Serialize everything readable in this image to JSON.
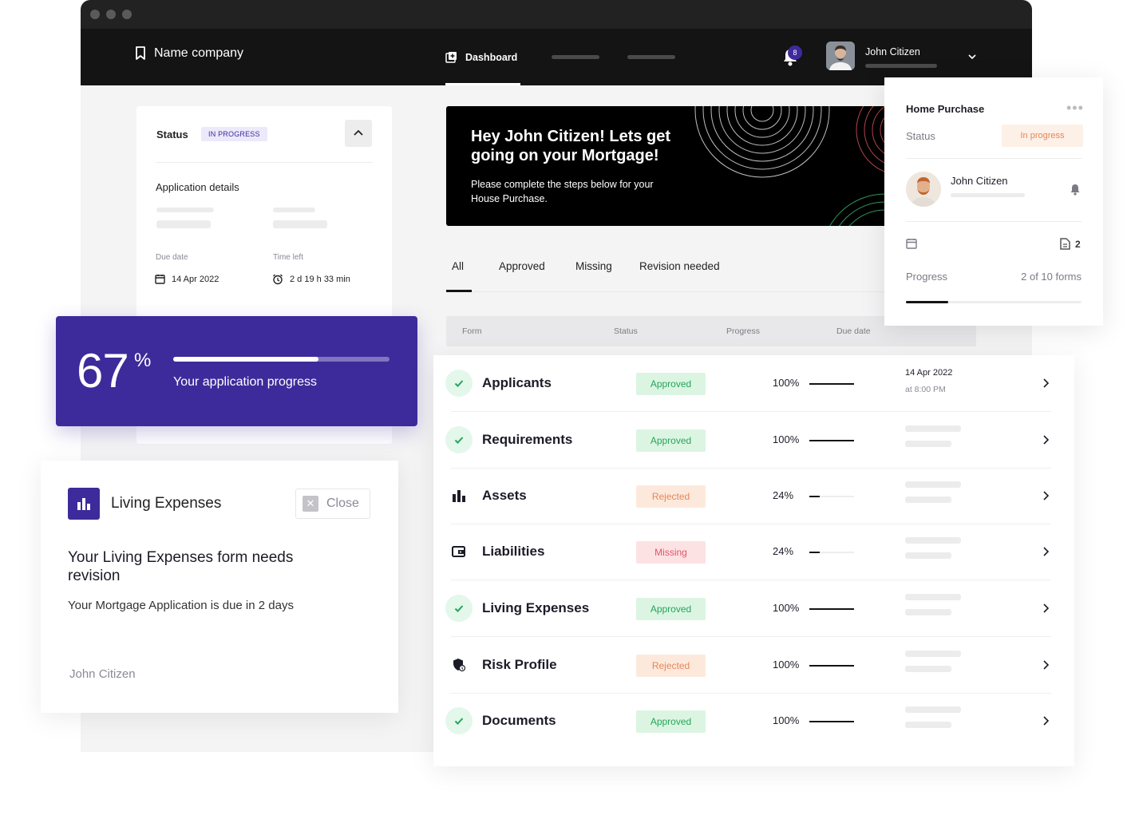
{
  "colors": {
    "accent": "#3d2b9b",
    "approved": "#25a55a",
    "rejected": "#e5865a",
    "missing": "#e15566"
  },
  "navbar": {
    "company": "Name company",
    "dashboard_label": "Dashboard",
    "notification_count": "8",
    "user_name": "John Citizen"
  },
  "status_panel": {
    "status_label": "Status",
    "status_badge": "IN PROGRESS",
    "section_title": "Application details",
    "due_date_label": "Due date",
    "due_date_value": "14 Apr 2022",
    "time_left_label": "Time left",
    "time_left_value": "2 d 19 h 33 min"
  },
  "progress_card": {
    "percent": "67",
    "percent_symbol": "%",
    "progress_fraction": 0.67,
    "label": "Your application progress"
  },
  "living_expenses": {
    "title": "Living Expenses",
    "close_label": "Close",
    "heading": "Your Living Expenses form needs revision",
    "subtext": "Your Mortgage Application is due in 2 days",
    "user": "John Citizen"
  },
  "hero": {
    "title": "Hey John Citizen! Lets get going on your Mortgage!",
    "subtitle": "Please complete the steps below for your House Purchase."
  },
  "tabs": [
    {
      "label": "All"
    },
    {
      "label": "Approved"
    },
    {
      "label": "Missing"
    },
    {
      "label": "Revision needed"
    }
  ],
  "table": {
    "headers": [
      "Form",
      "Status",
      "Progress",
      "Due date"
    ],
    "rows": [
      {
        "name": "Applicants",
        "icon": "check-icon",
        "status": "Approved",
        "progress": "100%",
        "fraction": 1.0,
        "due": "14 Apr 2022",
        "due_time": "at 8:00 PM"
      },
      {
        "name": "Requirements",
        "icon": "check-icon",
        "status": "Approved",
        "progress": "100%",
        "fraction": 1.0
      },
      {
        "name": "Assets",
        "icon": "bar-chart-icon",
        "status": "Rejected",
        "progress": "24%",
        "fraction": 0.24
      },
      {
        "name": "Liabilities",
        "icon": "wallet-icon",
        "status": "Missing",
        "progress": "24%",
        "fraction": 0.24
      },
      {
        "name": "Living Expenses",
        "icon": "check-icon",
        "status": "Approved",
        "progress": "100%",
        "fraction": 1.0
      },
      {
        "name": "Risk Profile",
        "icon": "shield-icon",
        "status": "Rejected",
        "progress": "100%",
        "fraction": 1.0
      },
      {
        "name": "Documents",
        "icon": "check-icon",
        "status": "Approved",
        "progress": "100%",
        "fraction": 1.0
      }
    ]
  },
  "home_purchase": {
    "title": "Home Purchase",
    "status_label": "Status",
    "status_value": "In progress",
    "user": "John Citizen",
    "doc_count": "2",
    "progress_label": "Progress",
    "progress_value": "2 of 10 forms",
    "progress_fraction": 0.24
  }
}
